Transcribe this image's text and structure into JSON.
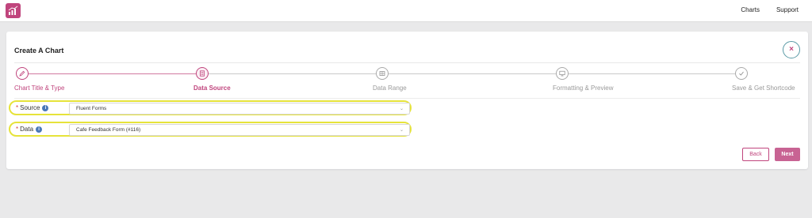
{
  "topbar": {
    "logo_icon": "bar-chart-icon",
    "nav": [
      {
        "label": "Charts"
      },
      {
        "label": "Support"
      }
    ]
  },
  "card": {
    "title": "Create A Chart",
    "close_icon": "close-icon",
    "close_glyph": "×"
  },
  "steps": [
    {
      "label": "Chart Title & Type",
      "icon": "pencil-icon",
      "state": "done"
    },
    {
      "label": "Data Source",
      "icon": "document-icon",
      "state": "active"
    },
    {
      "label": "Data Range",
      "icon": "grid-icon",
      "state": "pending"
    },
    {
      "label": "Formatting & Preview",
      "icon": "monitor-icon",
      "state": "pending"
    },
    {
      "label": "Save & Get Shortcode",
      "icon": "checkmark-icon",
      "state": "pending"
    }
  ],
  "form": {
    "source": {
      "required_mark": "*",
      "label": "Source",
      "info": "i",
      "value": "Fluent Forms"
    },
    "data": {
      "required_mark": "*",
      "label": "Data",
      "info": "i",
      "value": "Cafe Feedback Form (#116)"
    }
  },
  "actions": {
    "back_label": "Back",
    "next_label": "Next"
  },
  "colors": {
    "accent": "#c0457d",
    "highlight": "#e6e33a",
    "info": "#4a78b8"
  }
}
